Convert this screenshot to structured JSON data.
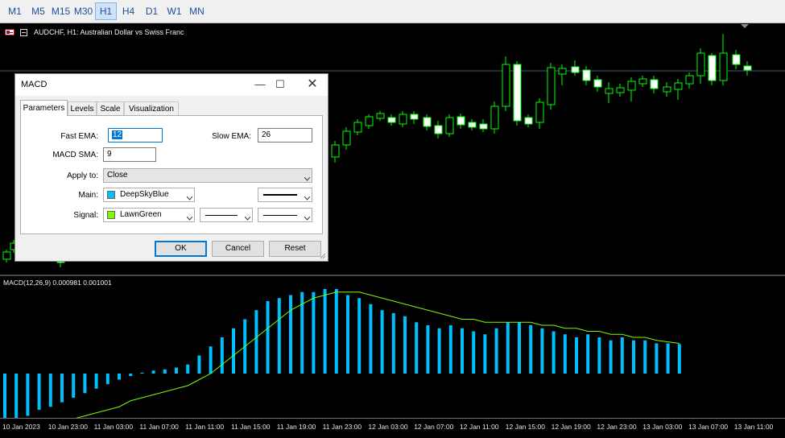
{
  "timeframes": [
    {
      "label": "M1",
      "active": false
    },
    {
      "label": "M5",
      "active": false
    },
    {
      "label": "M15",
      "active": false
    },
    {
      "label": "M30",
      "active": false
    },
    {
      "label": "H1",
      "active": true
    },
    {
      "label": "H4",
      "active": false
    },
    {
      "label": "D1",
      "active": false
    },
    {
      "label": "W1",
      "active": false
    },
    {
      "label": "MN",
      "active": false
    }
  ],
  "chart": {
    "title": "AUDCHF, H1:  Australian Dollar vs Swiss Franc",
    "colors": {
      "background": "#000000",
      "bull_candle": "#00ff00",
      "bear_candle": "#ffffff",
      "price_line": "#4a5a70"
    }
  },
  "indicator": {
    "label": "MACD(12,26,9) 0.000981 0.001001",
    "colors": {
      "main": "#00bfff",
      "signal": "#7cfc00"
    }
  },
  "time_axis": [
    "10 Jan 2023",
    "10 Jan 23:00",
    "11 Jan 03:00",
    "11 Jan 07:00",
    "11 Jan 11:00",
    "11 Jan 15:00",
    "11 Jan 19:00",
    "11 Jan 23:00",
    "12 Jan 03:00",
    "12 Jan 07:00",
    "12 Jan 11:00",
    "12 Jan 15:00",
    "12 Jan 19:00",
    "12 Jan 23:00",
    "13 Jan 03:00",
    "13 Jan 07:00",
    "13 Jan 11:00"
  ],
  "dialog": {
    "title": "MACD",
    "tabs": [
      {
        "label": "Parameters",
        "selected": true
      },
      {
        "label": "Levels",
        "selected": false
      },
      {
        "label": "Scale",
        "selected": false
      },
      {
        "label": "Visualization",
        "selected": false
      }
    ],
    "params": {
      "fast_ema_label": "Fast EMA:",
      "fast_ema": "12",
      "slow_ema_label": "Slow EMA:",
      "slow_ema": "26",
      "macd_sma_label": "MACD SMA:",
      "macd_sma": "9",
      "apply_to_label": "Apply to:",
      "apply_to": "Close",
      "main_label": "Main:",
      "main_color_name": "DeepSkyBlue",
      "main_color": "#00bfff",
      "signal_label": "Signal:",
      "signal_color_name": "LawnGreen",
      "signal_color": "#7cfc00"
    },
    "buttons": {
      "ok": "OK",
      "cancel": "Cancel",
      "reset": "Reset"
    }
  },
  "chart_data": {
    "type": "bar",
    "title": "MACD(12,26,9) 0.000981 0.001001",
    "xlabel": "",
    "ylabel": "",
    "categories": [
      "10 Jan 2023",
      "10 Jan 23:00",
      "11 Jan 03:00",
      "11 Jan 07:00",
      "11 Jan 11:00",
      "11 Jan 15:00",
      "11 Jan 19:00",
      "11 Jan 23:00",
      "12 Jan 03:00",
      "12 Jan 07:00",
      "12 Jan 11:00",
      "12 Jan 15:00",
      "12 Jan 19:00",
      "12 Jan 23:00",
      "13 Jan 03:00",
      "13 Jan 07:00",
      "13 Jan 11:00"
    ],
    "series": [
      {
        "name": "Main",
        "values": [
          -0.0018,
          -0.00165,
          -0.0014,
          -0.0012,
          -0.0011,
          -0.00095,
          -0.0008,
          -0.00065,
          -0.0005,
          -0.00035,
          -0.0002,
          -8e-05,
          3e-05,
          0.0001,
          0.00014,
          0.0002,
          0.0003,
          0.0006,
          0.0009,
          0.0012,
          0.0015,
          0.0018,
          0.0021,
          0.0024,
          0.0025,
          0.0026,
          0.0027,
          0.0027,
          0.0028,
          0.0028,
          0.0026,
          0.0025,
          0.0023,
          0.0021,
          0.002,
          0.0019,
          0.0017,
          0.0016,
          0.0015,
          0.0016,
          0.0015,
          0.0014,
          0.0013,
          0.0015,
          0.0017,
          0.0017,
          0.0016,
          0.0015,
          0.0014,
          0.0013,
          0.0012,
          0.0013,
          0.0012,
          0.0011,
          0.0012,
          0.0011,
          0.0011,
          0.001,
          0.001,
          0.00098
        ]
      },
      {
        "name": "Signal",
        "values": [
          -0.0021,
          -0.002,
          -0.0019,
          -0.0018,
          -0.0017,
          -0.0016,
          -0.0015,
          -0.0014,
          -0.0013,
          -0.0012,
          -0.0011,
          -0.0009,
          -0.0008,
          -0.0007,
          -0.0006,
          -0.0005,
          -0.0004,
          -0.0002,
          0.0,
          0.0003,
          0.0006,
          0.0009,
          0.0012,
          0.0015,
          0.0018,
          0.0021,
          0.0023,
          0.0025,
          0.0026,
          0.0027,
          0.0027,
          0.0027,
          0.0026,
          0.0025,
          0.0024,
          0.0023,
          0.0022,
          0.0021,
          0.002,
          0.0019,
          0.0018,
          0.0018,
          0.0017,
          0.0017,
          0.0017,
          0.0017,
          0.0017,
          0.0016,
          0.0016,
          0.0015,
          0.0015,
          0.0014,
          0.0014,
          0.0013,
          0.0013,
          0.0012,
          0.0012,
          0.0011,
          0.00105,
          0.001
        ]
      }
    ],
    "grid": false,
    "legend": "none"
  }
}
